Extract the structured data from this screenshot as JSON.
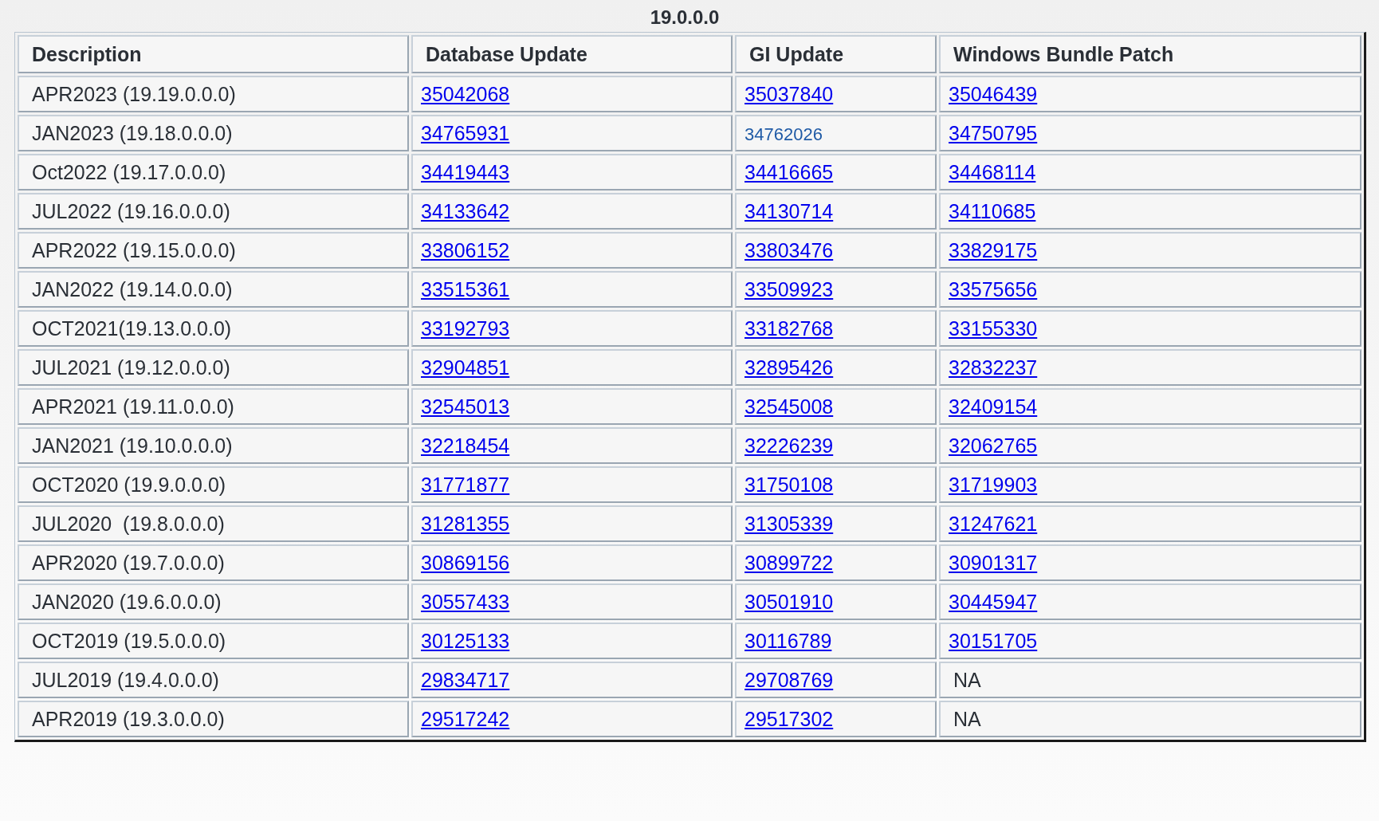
{
  "title": "19.0.0.0",
  "table": {
    "columns": [
      "Description",
      "Database Update",
      "GI Update",
      "Windows Bundle Patch"
    ],
    "rows": [
      [
        {
          "text": "APR2023 (19.19.0.0.0)",
          "kind": "text"
        },
        {
          "text": "35042068",
          "kind": "link"
        },
        {
          "text": "35037840",
          "kind": "link"
        },
        {
          "text": "35046439",
          "kind": "link"
        }
      ],
      [
        {
          "text": "JAN2023 (19.18.0.0.0)",
          "kind": "text"
        },
        {
          "text": "34765931",
          "kind": "link"
        },
        {
          "text": "34762026",
          "kind": "plain"
        },
        {
          "text": "34750795",
          "kind": "link"
        }
      ],
      [
        {
          "text": "Oct2022 (19.17.0.0.0)",
          "kind": "text"
        },
        {
          "text": "34419443",
          "kind": "link"
        },
        {
          "text": "34416665",
          "kind": "link"
        },
        {
          "text": "34468114",
          "kind": "link"
        }
      ],
      [
        {
          "text": "JUL2022 (19.16.0.0.0)",
          "kind": "text"
        },
        {
          "text": "34133642",
          "kind": "link"
        },
        {
          "text": "34130714",
          "kind": "link"
        },
        {
          "text": "34110685",
          "kind": "link"
        }
      ],
      [
        {
          "text": "APR2022 (19.15.0.0.0)",
          "kind": "text"
        },
        {
          "text": "33806152",
          "kind": "link"
        },
        {
          "text": "33803476",
          "kind": "link"
        },
        {
          "text": "33829175",
          "kind": "link"
        }
      ],
      [
        {
          "text": "JAN2022 (19.14.0.0.0)",
          "kind": "text"
        },
        {
          "text": "33515361",
          "kind": "link"
        },
        {
          "text": "33509923",
          "kind": "link"
        },
        {
          "text": "33575656",
          "kind": "link"
        }
      ],
      [
        {
          "text": "OCT2021(19.13.0.0.0)",
          "kind": "text"
        },
        {
          "text": "33192793",
          "kind": "link"
        },
        {
          "text": "33182768",
          "kind": "link"
        },
        {
          "text": "33155330",
          "kind": "link"
        }
      ],
      [
        {
          "text": "JUL2021 (19.12.0.0.0)",
          "kind": "text"
        },
        {
          "text": "32904851",
          "kind": "link"
        },
        {
          "text": "32895426",
          "kind": "link"
        },
        {
          "text": "32832237",
          "kind": "link"
        }
      ],
      [
        {
          "text": "APR2021 (19.11.0.0.0)",
          "kind": "text"
        },
        {
          "text": "32545013",
          "kind": "link"
        },
        {
          "text": "32545008",
          "kind": "link"
        },
        {
          "text": "32409154",
          "kind": "link"
        }
      ],
      [
        {
          "text": "JAN2021 (19.10.0.0.0)",
          "kind": "text"
        },
        {
          "text": "32218454",
          "kind": "link"
        },
        {
          "text": "32226239",
          "kind": "link"
        },
        {
          "text": "32062765",
          "kind": "link"
        }
      ],
      [
        {
          "text": "OCT2020 (19.9.0.0.0)",
          "kind": "text"
        },
        {
          "text": "31771877",
          "kind": "link"
        },
        {
          "text": "31750108",
          "kind": "link"
        },
        {
          "text": "31719903",
          "kind": "link"
        }
      ],
      [
        {
          "text": "JUL2020  (19.8.0.0.0)",
          "kind": "text"
        },
        {
          "text": "31281355",
          "kind": "link"
        },
        {
          "text": "31305339",
          "kind": "link"
        },
        {
          "text": "31247621",
          "kind": "link"
        }
      ],
      [
        {
          "text": "APR2020 (19.7.0.0.0)",
          "kind": "text"
        },
        {
          "text": "30869156",
          "kind": "link"
        },
        {
          "text": "30899722",
          "kind": "link"
        },
        {
          "text": "30901317",
          "kind": "link"
        }
      ],
      [
        {
          "text": "JAN2020 (19.6.0.0.0)",
          "kind": "text"
        },
        {
          "text": "30557433",
          "kind": "link"
        },
        {
          "text": "30501910",
          "kind": "link"
        },
        {
          "text": "30445947",
          "kind": "link"
        }
      ],
      [
        {
          "text": "OCT2019 (19.5.0.0.0)",
          "kind": "text"
        },
        {
          "text": "30125133",
          "kind": "link"
        },
        {
          "text": "30116789",
          "kind": "link"
        },
        {
          "text": "30151705",
          "kind": "link"
        }
      ],
      [
        {
          "text": "JUL2019 (19.4.0.0.0)",
          "kind": "text"
        },
        {
          "text": "29834717",
          "kind": "link"
        },
        {
          "text": "29708769",
          "kind": "link"
        },
        {
          "text": "NA",
          "kind": "text"
        }
      ],
      [
        {
          "text": "APR2019 (19.3.0.0.0)",
          "kind": "text"
        },
        {
          "text": "29517242",
          "kind": "link"
        },
        {
          "text": "29517302",
          "kind": "link"
        },
        {
          "text": "NA",
          "kind": "text"
        }
      ]
    ]
  }
}
